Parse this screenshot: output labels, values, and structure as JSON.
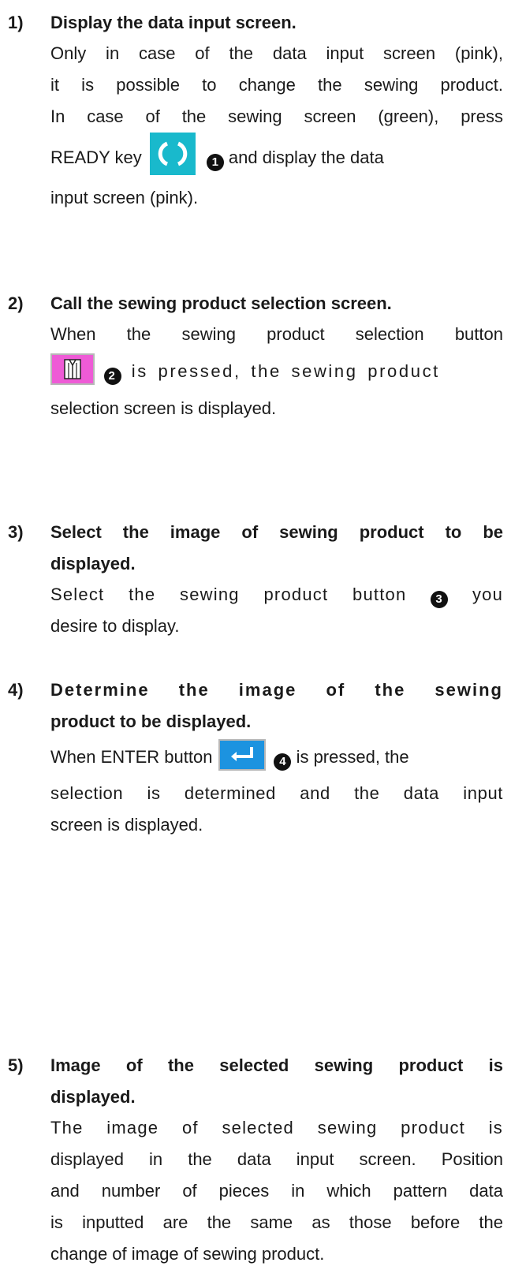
{
  "steps": [
    {
      "number": "1)",
      "title": "Display the data input screen.",
      "body": {
        "l1": "Only in case of the data input screen (pink),",
        "l2": "it is possible to change the sewing product.",
        "l3": "In case of the sewing screen (green), press",
        "l4_before": "READY key",
        "l4_marker": "1",
        "l4_after": "and display the data",
        "l5": "input screen (pink)."
      },
      "icon": "ready-key-icon"
    },
    {
      "number": "2)",
      "title": "Call the sewing product selection screen.",
      "body": {
        "l1": "When the sewing product selection button",
        "l2_marker": "2",
        "l2_after": "is pressed, the sewing product",
        "l3": "selection screen is displayed."
      },
      "icon": "shirt-icon"
    },
    {
      "number": "3)",
      "title_l1": "Select the image of sewing product to be",
      "title_l2": "displayed.",
      "body": {
        "l1_before": "Select the sewing product button",
        "l1_marker": "3",
        "l1_after": "you",
        "l2": "desire to display."
      }
    },
    {
      "number": "4)",
      "title_l1": "Determine the image of the sewing",
      "title_l2": "product to be displayed.",
      "body": {
        "l1_before": "When ENTER button",
        "l1_marker": "4",
        "l1_after": "is pressed, the",
        "l2": "selection is determined and the data input",
        "l3": "screen is displayed."
      },
      "icon": "enter-icon"
    },
    {
      "number": "5)",
      "title_l1": "Image of the selected sewing product is",
      "title_l2": "displayed.",
      "body": {
        "l1": "The image of selected sewing product is",
        "l2": "displayed in the data input screen. Position",
        "l3": "and number of pieces in which pattern data",
        "l4": "is inputted are the same as those before the",
        "l5": "change of image of sewing product."
      }
    }
  ],
  "colors": {
    "ready_key": "#19b9cc",
    "product_button": "#ee5bd6",
    "enter_button": "#1c93e0"
  }
}
